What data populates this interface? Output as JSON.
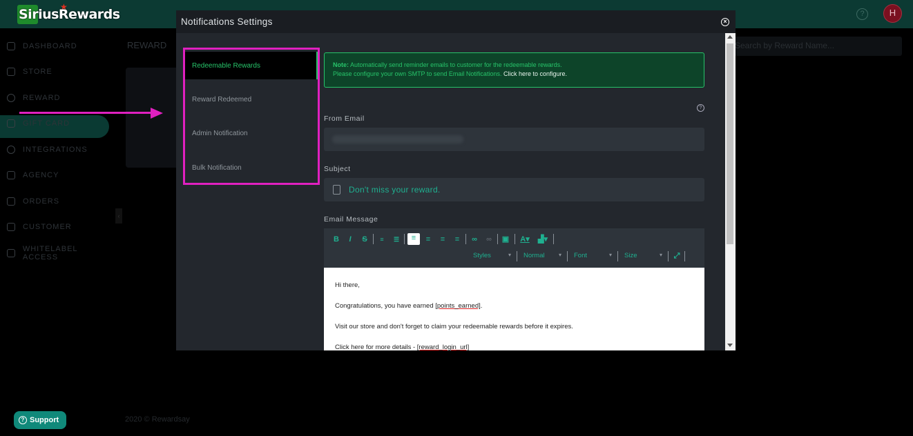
{
  "app": {
    "logo_text": "SiriusRewards",
    "avatar_initial": "H"
  },
  "sidebar": {
    "items": [
      {
        "label": "DASHBOARD"
      },
      {
        "label": "STORE"
      },
      {
        "label": "REWARD"
      },
      {
        "label": "GIFT CARD"
      },
      {
        "label": "INTEGRATIONS"
      },
      {
        "label": "AGENCY"
      },
      {
        "label": "ORDERS"
      },
      {
        "label": "CUSTOMER"
      },
      {
        "label": "WHITELABEL ACCESS"
      }
    ]
  },
  "main": {
    "title": "REWARD",
    "search_placeholder": "Search by Reward Name...",
    "footer": "2020 © Rewardsay",
    "support_label": "Support"
  },
  "modal": {
    "title": "Notifications Settings",
    "tabs": [
      {
        "label": "Redeemable Rewards"
      },
      {
        "label": "Reward Redeemed"
      },
      {
        "label": "Admin Notification"
      },
      {
        "label": "Bulk Notification"
      }
    ],
    "note": {
      "prefix": "Note:",
      "line1": "Automatically send reminder emails to customer for the redeemable rewards.",
      "line2": "Please configure your own SMTP to send Email Notifications.",
      "link": "Click here to configure."
    },
    "from_email_label": "From Email",
    "subject_label": "Subject",
    "subject_value": "Don't miss your reward.",
    "email_message_label": "Email Message",
    "toolbar": {
      "styles": "Styles",
      "format": "Normal",
      "font": "Font",
      "size": "Size"
    },
    "body": {
      "greeting": "Hi there,",
      "line1_prefix": "Congratulations, you have earned ",
      "line1_tag": "[points_earned]",
      "line1_suffix": ".",
      "line2": "Visit our store and don't forget to claim your redeemable rewards before it expires.",
      "line3_prefix": "Click here for more details - ",
      "line3_tag": "[reward_login_url]"
    }
  },
  "colors": {
    "accent_green": "#27c46a",
    "teal": "#1fb090",
    "highlight_magenta": "#e020c0"
  }
}
